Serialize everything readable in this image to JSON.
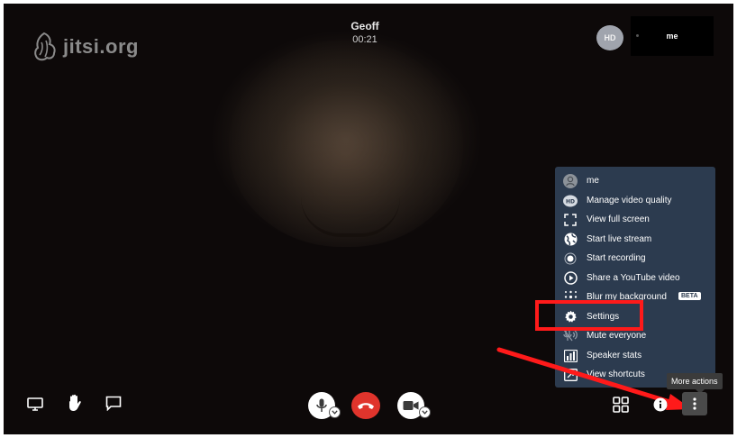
{
  "logo": {
    "text": "jitsi.org",
    "icon": "jitsi-logo-icon"
  },
  "caller": {
    "name": "Geoff",
    "duration": "00:21"
  },
  "thumbnails": {
    "quality_badge": "HD",
    "self_label": "me"
  },
  "more_menu": {
    "items": [
      {
        "label": "me",
        "icon": "avatar-icon"
      },
      {
        "label": "Manage video quality",
        "icon": "hd-icon"
      },
      {
        "label": "View full screen",
        "icon": "fullscreen-icon"
      },
      {
        "label": "Start live stream",
        "icon": "globe-icon"
      },
      {
        "label": "Start recording",
        "icon": "record-icon"
      },
      {
        "label": "Share a YouTube video",
        "icon": "play-circle-icon"
      },
      {
        "label": "Blur my background",
        "icon": "blur-icon",
        "badge": "BETA"
      },
      {
        "label": "Settings",
        "icon": "gear-icon"
      },
      {
        "label": "Mute everyone",
        "icon": "mute-all-icon"
      },
      {
        "label": "Speaker stats",
        "icon": "bar-chart-icon"
      },
      {
        "label": "View shortcuts",
        "icon": "shortcuts-icon"
      }
    ]
  },
  "tooltip": {
    "text": "More actions"
  },
  "toolbar": {
    "left": [
      "screen-share-icon",
      "raise-hand-icon",
      "chat-icon"
    ],
    "center": [
      "microphone-icon",
      "hangup-icon",
      "camera-icon"
    ],
    "right": [
      "tile-view-icon",
      "info-icon",
      "more-actions-icon"
    ]
  },
  "colors": {
    "menu_bg": "#2c3b4f",
    "hangup": "#e0342c",
    "annotation": "#ff1a1a"
  }
}
